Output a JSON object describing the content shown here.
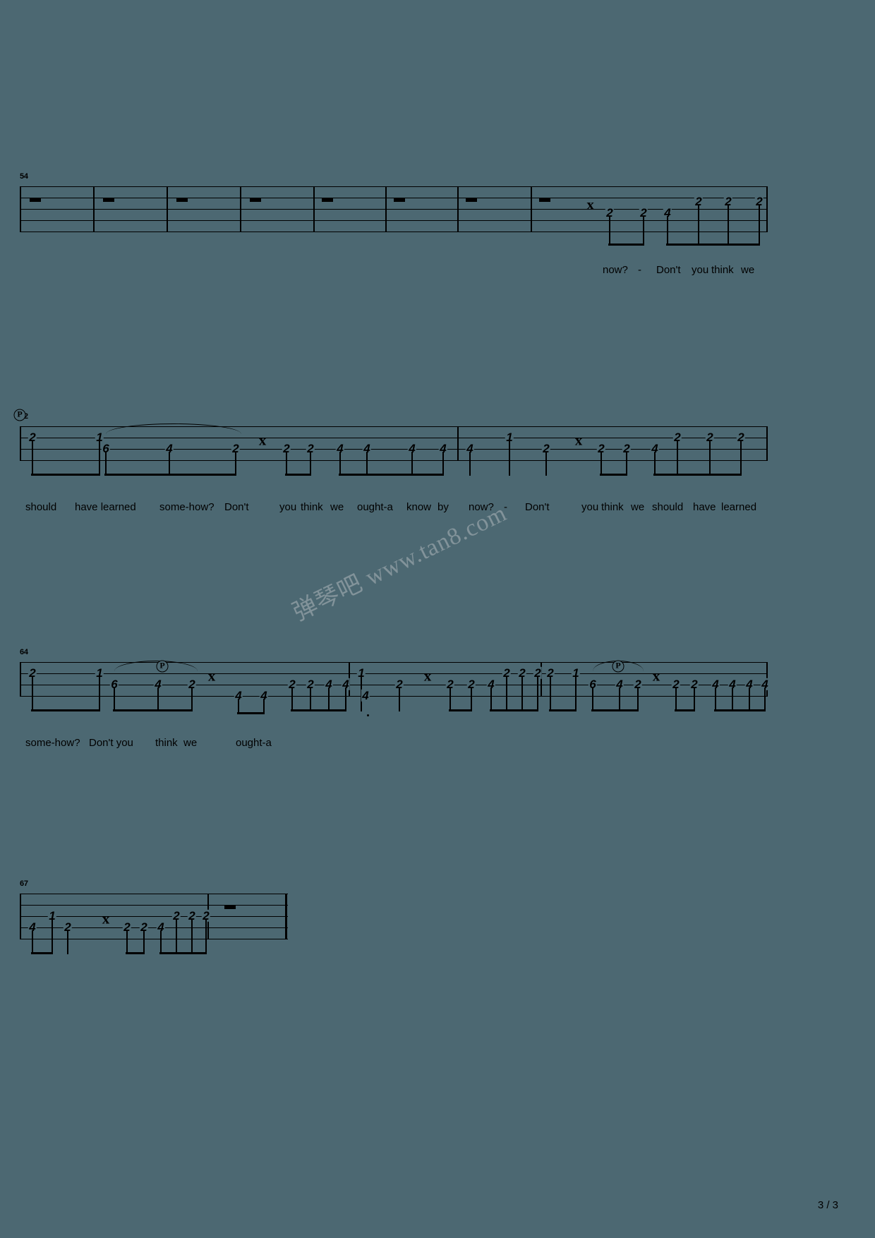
{
  "document": {
    "type": "guitar-tablature",
    "page_label": "3 / 3",
    "watermark": "弹琴吧 www.tan8.com",
    "background_color": "#4c6872",
    "ink_color": "#000000"
  },
  "systems": [
    {
      "id": "system-1",
      "measure_number": "54",
      "measures": [
        {
          "index": 1,
          "rest": "whole"
        },
        {
          "index": 2,
          "rest": "whole"
        },
        {
          "index": 3,
          "rest": "whole"
        },
        {
          "index": 4,
          "rest": "whole"
        },
        {
          "index": 5,
          "rest": "whole"
        },
        {
          "index": 6,
          "rest": "whole"
        },
        {
          "index": 7,
          "rest": "whole"
        },
        {
          "index": 8,
          "rest": "half-then-notes",
          "notes": [
            "2",
            "2",
            "4",
            "2",
            "2",
            "2"
          ]
        }
      ],
      "frets": [
        "2",
        "2",
        "4",
        "2",
        "2",
        "2"
      ],
      "lyrics": [
        "now?",
        "-",
        "Don't",
        "you",
        "think",
        "we"
      ]
    },
    {
      "id": "system-2",
      "measure_number": "62",
      "frets": [
        "2",
        "1",
        "6",
        "4",
        "2",
        "2",
        "2",
        "4",
        "4",
        "4",
        "4",
        "4",
        "1",
        "2",
        "2",
        "2",
        "4",
        "2",
        "2",
        "2"
      ],
      "lyrics": [
        "should",
        "have learned",
        "some-how?",
        "Don't",
        "you",
        "think",
        "we",
        "ought-a",
        "know",
        "by",
        "now?",
        "-",
        "Don't",
        "you",
        "think",
        "we",
        "should",
        "have",
        "learned"
      ]
    },
    {
      "id": "system-3",
      "measure_number": "64",
      "frets": [
        "2",
        "1",
        "6",
        "4",
        "2",
        "4",
        "4",
        "2",
        "2",
        "4",
        "4",
        "1",
        "4",
        "2",
        "2",
        "2",
        "4",
        "2",
        "2",
        "2",
        "2",
        "1",
        "6",
        "4",
        "2",
        "2",
        "2",
        "4",
        "4",
        "4",
        "4"
      ],
      "lyrics": [
        "some-how?",
        "Don't you",
        "think",
        "we",
        "ought-a"
      ]
    },
    {
      "id": "system-4",
      "measure_number": "67",
      "frets": [
        "4",
        "1",
        "2",
        "2",
        "2",
        "4",
        "2",
        "2",
        "2"
      ],
      "lyrics": []
    }
  ]
}
